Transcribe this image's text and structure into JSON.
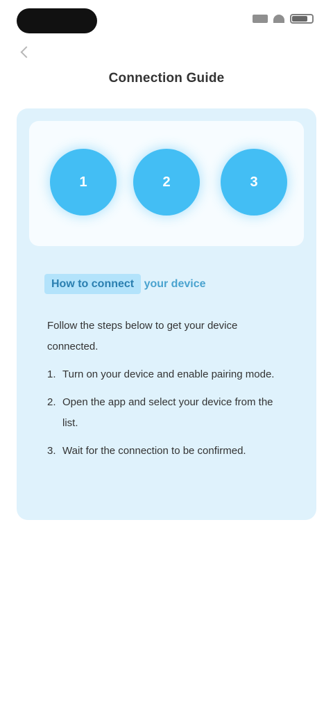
{
  "status_bar": {
    "icons": [
      "signal-icon",
      "wifi-icon",
      "battery-icon"
    ]
  },
  "nav": {
    "back_icon": "chevron-left-icon",
    "title": "Connection Guide"
  },
  "card": {
    "colors": {
      "card_bg": "#dff2fc",
      "circle": "#43bef4",
      "highlight": "#b3e3fb"
    },
    "circles": [
      {
        "label": "1"
      },
      {
        "label": "2"
      },
      {
        "label": "3"
      }
    ],
    "heading_highlight": "How to connect",
    "heading_rest": "your device",
    "intro": "Follow the steps below to get your device connected.",
    "steps": [
      {
        "num": "1.",
        "text": "Turn on your device and enable pairing mode."
      },
      {
        "num": "2.",
        "text": "Open the app and select your device from the list."
      },
      {
        "num": "3.",
        "text": "Wait for the connection to be confirmed."
      }
    ]
  }
}
